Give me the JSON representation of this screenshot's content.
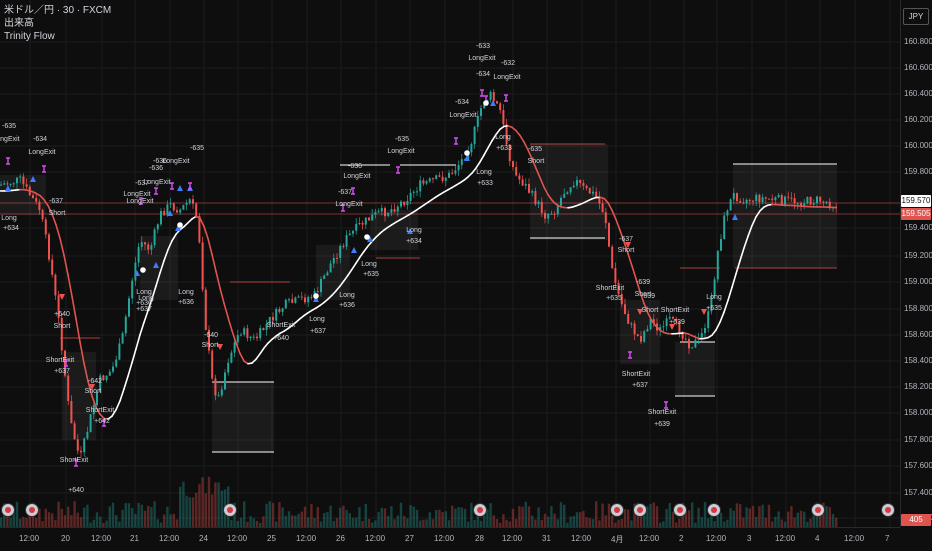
{
  "legend": {
    "symbol": "米ドル／円 · 30 · FXCM",
    "volume": "出来高",
    "indicator": "Trinity Flow"
  },
  "currency": "JPY",
  "price_axis": {
    "ticks": [
      "160.800",
      "160.600",
      "160.400",
      "160.200",
      "160.000",
      "159.800",
      "159.400",
      "159.200",
      "159.000",
      "158.800",
      "158.600",
      "158.400",
      "158.200",
      "158.000",
      "157.800",
      "157.600",
      "157.400",
      "157.200"
    ],
    "current_price": "159.570",
    "current_price_alt": "159.505",
    "volume_badge": "405"
  },
  "time_axis": [
    "12:00",
    "20",
    "12:00",
    "21",
    "12:00",
    "24",
    "12:00",
    "25",
    "12:00",
    "26",
    "12:00",
    "27",
    "12:00",
    "28",
    "12:00",
    "31",
    "12:00",
    "4月",
    "12:00",
    "2",
    "12:00",
    "3",
    "12:00",
    "4",
    "12:00",
    "7"
  ],
  "signals": [
    {
      "t": "-635"
    },
    {
      "t": "LongExit"
    },
    {
      "t": "-634"
    },
    {
      "t": "LongExit"
    },
    {
      "t": "Long"
    },
    {
      "t": "+634"
    },
    {
      "t": "-637"
    },
    {
      "t": "Short"
    },
    {
      "t": "+640"
    },
    {
      "t": "Short"
    },
    {
      "t": "ShortExit"
    },
    {
      "t": "+637"
    },
    {
      "t": "-642"
    },
    {
      "t": "Short"
    },
    {
      "t": "ShortExit"
    },
    {
      "t": "+642"
    },
    {
      "t": "ShortExit"
    },
    {
      "t": "+640"
    },
    {
      "t": "-637"
    },
    {
      "t": "LongExit"
    },
    {
      "t": "-636"
    },
    {
      "t": "LongExit"
    },
    {
      "t": "LongExit"
    },
    {
      "t": "-636"
    },
    {
      "t": "LongExit"
    },
    {
      "t": "-635"
    },
    {
      "t": "Long"
    },
    {
      "t": "+636"
    },
    {
      "t": "Long"
    },
    {
      "t": "+637"
    },
    {
      "t": "Long"
    },
    {
      "t": "+636"
    },
    {
      "t": "-640"
    },
    {
      "t": "Short"
    },
    {
      "t": "ShortExit"
    },
    {
      "t": "+640"
    },
    {
      "t": "-637"
    },
    {
      "t": "LongExit"
    },
    {
      "t": "-636"
    },
    {
      "t": "LongExit"
    },
    {
      "t": "-635"
    },
    {
      "t": "LongExit"
    },
    {
      "t": "Long"
    },
    {
      "t": "+637"
    },
    {
      "t": "Long"
    },
    {
      "t": "+636"
    },
    {
      "t": "Long"
    },
    {
      "t": "+635"
    },
    {
      "t": "Long"
    },
    {
      "t": "+634"
    },
    {
      "t": "-634"
    },
    {
      "t": "LongExit"
    },
    {
      "t": "-633"
    },
    {
      "t": "LongExit"
    },
    {
      "t": "-634"
    },
    {
      "t": "-632"
    },
    {
      "t": "LongExit"
    },
    {
      "t": "Long"
    },
    {
      "t": "+633"
    },
    {
      "t": "Long"
    },
    {
      "t": "+633"
    },
    {
      "t": "-635"
    },
    {
      "t": "Short"
    },
    {
      "t": "-637"
    },
    {
      "t": "Short"
    },
    {
      "t": "ShortExit"
    },
    {
      "t": "+635"
    },
    {
      "t": "-639"
    },
    {
      "t": "Short"
    },
    {
      "t": "ShortExit"
    },
    {
      "t": "+637"
    },
    {
      "t": "-639"
    },
    {
      "t": "Short"
    },
    {
      "t": "ShortExit"
    },
    {
      "t": "+639"
    },
    {
      "t": "ShortExit"
    },
    {
      "t": "+639"
    },
    {
      "t": "Long"
    },
    {
      "t": "+635"
    }
  ],
  "colors": {
    "background": "#0e0e0e",
    "up_candle": "#26a69a",
    "down_candle": "#ef5350",
    "ma_line": "#ffffff",
    "ma_red": "#e0544f",
    "long_marker": "#3d7bff",
    "exit_marker": "#c03ee0",
    "price_tag": "#ffffff",
    "price_tag_alt": "#e0544f"
  }
}
